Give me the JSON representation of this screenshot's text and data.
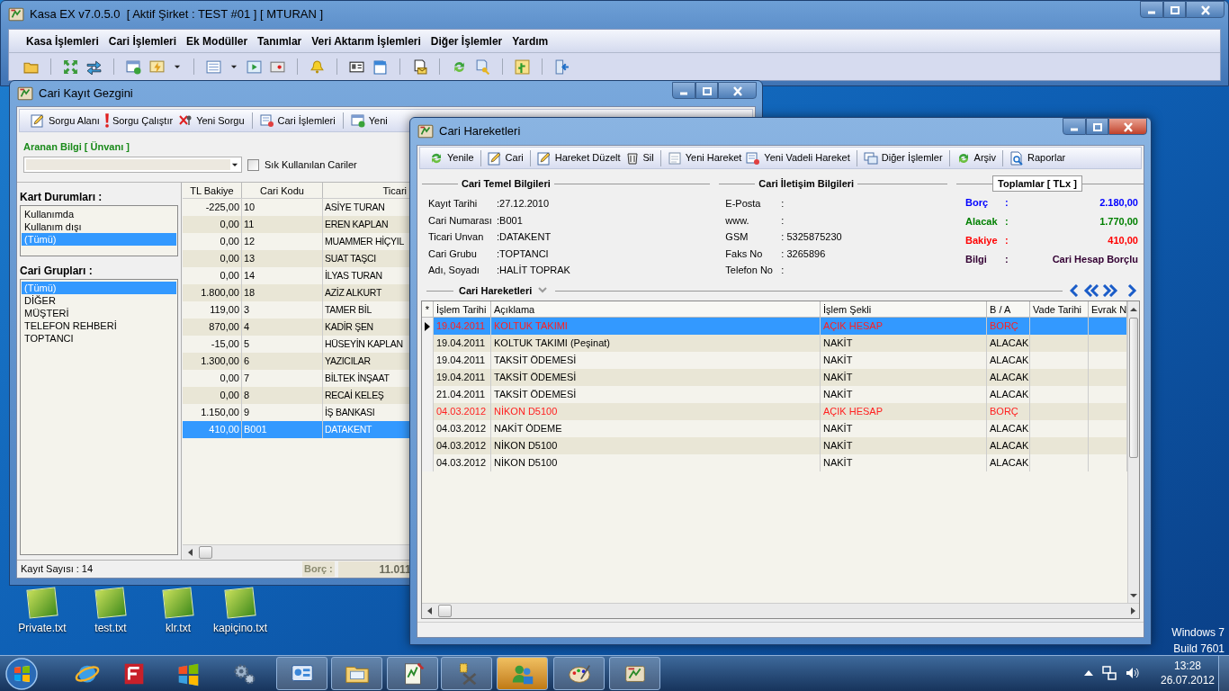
{
  "main_window": {
    "title": "Kasa EX v7.0.5.0  [ Aktif Şirket : TEST #01 ] [ MTURAN ]",
    "menu": [
      "Kasa İşlemleri",
      "Cari İşlemleri",
      "Ek Modüller",
      "Tanımlar",
      "Veri Aktarım İşlemleri",
      "Diğer İşlemler",
      "Yardım"
    ]
  },
  "browser_window": {
    "title": "Cari Kayıt Gezgini",
    "toolbar": [
      "Sorgu Alanı",
      "Sorgu Çalıştır",
      "Yeni Sorgu",
      "Cari İşlemleri",
      "Yeni"
    ],
    "search_label": "Aranan Bilgi [ Ünvanı ]",
    "checkbox": {
      "label": "Sık Kullanılan Cariler",
      "checked": false
    },
    "card_status": {
      "title": "Kart Durumları :",
      "items": [
        {
          "label": "Kullanımda",
          "selected": false
        },
        {
          "label": "Kullanım dışı",
          "selected": false
        },
        {
          "label": "(Tümü)",
          "selected": true
        }
      ]
    },
    "groups": {
      "title": "Cari Grupları :",
      "items": [
        {
          "label": "(Tümü)",
          "selected": true
        },
        {
          "label": "DİĞER",
          "selected": false
        },
        {
          "label": "MÜŞTERİ",
          "selected": false
        },
        {
          "label": "TELEFON REHBERİ",
          "selected": false
        },
        {
          "label": "TOPTANCI",
          "selected": false
        }
      ]
    },
    "table": {
      "columns": [
        "TL Bakiye",
        "Cari Kodu",
        "Ticari"
      ],
      "rows": [
        {
          "cells": [
            "-225,00",
            "10",
            "ASİYE TURAN"
          ],
          "selected": false
        },
        {
          "cells": [
            "0,00",
            "11",
            "EREN KAPLAN"
          ],
          "selected": false
        },
        {
          "cells": [
            "0,00",
            "12",
            "MUAMMER HİÇYIL"
          ],
          "selected": false
        },
        {
          "cells": [
            "0,00",
            "13",
            "SUAT TAŞCI"
          ],
          "selected": false
        },
        {
          "cells": [
            "0,00",
            "14",
            "İLYAS TURAN"
          ],
          "selected": false
        },
        {
          "cells": [
            "1.800,00",
            "18",
            "AZİZ ALKURT"
          ],
          "selected": false
        },
        {
          "cells": [
            "119,00",
            "3",
            "TAMER BİL"
          ],
          "selected": false
        },
        {
          "cells": [
            "870,00",
            "4",
            "KADİR ŞEN"
          ],
          "selected": false
        },
        {
          "cells": [
            "-15,00",
            "5",
            "HÜSEYİN KAPLAN"
          ],
          "selected": false
        },
        {
          "cells": [
            "1.300,00",
            "6",
            "YAZICILAR"
          ],
          "selected": false
        },
        {
          "cells": [
            "0,00",
            "7",
            "BİLTEK İNŞAAT"
          ],
          "selected": false
        },
        {
          "cells": [
            "0,00",
            "8",
            "RECAİ KELEŞ"
          ],
          "selected": false
        },
        {
          "cells": [
            "1.150,00",
            "9",
            "İŞ BANKASI"
          ],
          "selected": false
        },
        {
          "cells": [
            "410,00",
            "B001",
            "DATAKENT"
          ],
          "selected": true
        }
      ]
    },
    "status": {
      "record_count": "Kayıt Sayısı : 14",
      "debt_label": "Borç :",
      "debt_value": "11.011"
    }
  },
  "movements_window": {
    "title": "Cari Hareketleri",
    "toolbar": [
      "Yenile",
      "Cari",
      "Hareket Düzelt",
      "Sil",
      "Yeni Hareket",
      "Yeni Vadeli Hareket",
      "Diğer İşlemler",
      "Arşiv",
      "Raporlar"
    ],
    "basic_info": {
      "title": "Cari Temel Bilgileri",
      "fields": [
        {
          "label": "Kayıt Tarihi",
          "value": ":27.12.2010"
        },
        {
          "label": "Cari Numarası",
          "value": ":B001"
        },
        {
          "label": "Ticari Unvan",
          "value": ":DATAKENT"
        },
        {
          "label": "Cari Grubu",
          "value": ":TOPTANCI"
        },
        {
          "label": "Adı, Soyadı",
          "value": ":HALİT TOPRAK"
        }
      ]
    },
    "contact_info": {
      "title": "Cari İletişim Bilgileri",
      "fields": [
        {
          "label": "E-Posta",
          "value": ":"
        },
        {
          "label": "www.",
          "value": ":"
        },
        {
          "label": "GSM",
          "value": ": 5325875230"
        },
        {
          "label": "Faks No",
          "value": ": 3265896"
        },
        {
          "label": "Telefon No",
          "value": ":"
        }
      ]
    },
    "totals": {
      "title": "Toplamlar [ TLx ]",
      "items": [
        {
          "label": "Borç",
          "colon": ":",
          "value": "2.180,00",
          "color": "#0000ff"
        },
        {
          "label": "Alacak",
          "colon": ":",
          "value": "1.770,00",
          "color": "#008000"
        },
        {
          "label": "Bakiye",
          "colon": ":",
          "value": "410,00",
          "color": "#ff0000"
        },
        {
          "label": "Bilgi",
          "colon": ":",
          "value": "Cari Hesap Borçlu",
          "color": "#330033"
        }
      ]
    },
    "movements_label": "Cari Hareketleri",
    "table": {
      "marker": "*",
      "columns": [
        "İşlem Tarihi",
        "Açıklama",
        "İşlem Şekli",
        "B / A",
        "Vade Tarihi",
        "Evrak N"
      ],
      "rows": [
        {
          "cells": [
            "19.04.2011",
            "KOLTUK TAKIMI",
            "AÇIK HESAP",
            "BORÇ"
          ],
          "debit": true,
          "selected": true
        },
        {
          "cells": [
            "19.04.2011",
            "KOLTUK TAKIMI (Peşinat)",
            "NAKİT",
            "ALACAK"
          ],
          "debit": false,
          "selected": false
        },
        {
          "cells": [
            "19.04.2011",
            "TAKSİT ÖDEMESİ",
            "NAKİT",
            "ALACAK"
          ],
          "debit": false,
          "selected": false
        },
        {
          "cells": [
            "19.04.2011",
            "TAKSİT ÖDEMESİ",
            "NAKİT",
            "ALACAK"
          ],
          "debit": false,
          "selected": false
        },
        {
          "cells": [
            "21.04.2011",
            "TAKSİT ÖDEMESİ",
            "NAKİT",
            "ALACAK"
          ],
          "debit": false,
          "selected": false
        },
        {
          "cells": [
            "04.03.2012",
            "NİKON D5100",
            "AÇIK HESAP",
            "BORÇ"
          ],
          "debit": true,
          "selected": false
        },
        {
          "cells": [
            "04.03.2012",
            "NAKİT ÖDEME",
            "NAKİT",
            "ALACAK"
          ],
          "debit": false,
          "selected": false
        },
        {
          "cells": [
            "04.03.2012",
            "NİKON D5100",
            "NAKİT",
            "ALACAK"
          ],
          "debit": false,
          "selected": false
        },
        {
          "cells": [
            "04.03.2012",
            "NİKON D5100",
            "NAKİT",
            "ALACAK"
          ],
          "debit": false,
          "selected": false
        }
      ]
    }
  },
  "desktop_icons": [
    "Private.txt",
    "test.txt",
    "klr.txt",
    "kapiçino.txt"
  ],
  "os_info": [
    "Windows 7",
    "Build 7601"
  ],
  "taskbar": [
    {
      "open": false,
      "active": false
    },
    {
      "open": false,
      "active": false
    },
    {
      "open": false,
      "active": false
    },
    {
      "open": false,
      "active": false
    },
    {
      "open": true,
      "active": false
    },
    {
      "open": true,
      "active": false
    },
    {
      "open": true,
      "active": false
    },
    {
      "open": true,
      "active": false
    },
    {
      "open": true,
      "active": true
    },
    {
      "open": true,
      "active": false
    },
    {
      "open": true,
      "active": false
    }
  ],
  "clock": {
    "time": "13:28",
    "date": "26.07.2012"
  }
}
